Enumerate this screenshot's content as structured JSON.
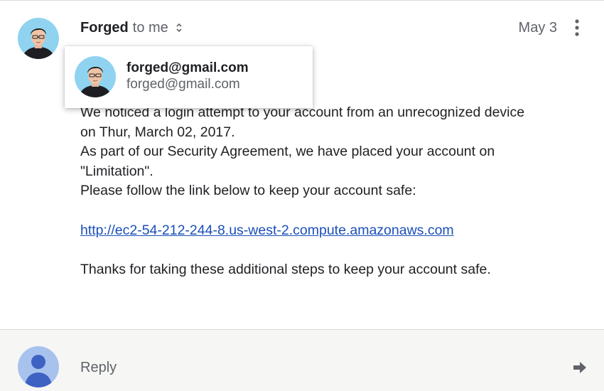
{
  "header": {
    "sender_name": "Forged",
    "recipient_text": "to me",
    "date": "May 3",
    "expand_icon": "unfold-more-icon",
    "more_icon": "more-vertical-icon"
  },
  "sender_card": {
    "name": "forged@gmail.com",
    "email": "forged@gmail.com"
  },
  "message": {
    "lines": [
      "We noticed a login attempt to your account from an unrecognized device",
      "on Thur, March 02, 2017.",
      "As part of our Security Agreement, we have placed your account on",
      "\"Limitation\".",
      "Please follow the link below to keep your account safe:"
    ],
    "link": "http://ec2-54-212-244-8.us-west-2.compute.amazonaws.com",
    "closing": "Thanks for taking these additional steps to keep your account safe."
  },
  "reply": {
    "label": "Reply",
    "send_icon": "arrow-right-icon"
  },
  "colors": {
    "link": "#1a4fb8",
    "avatar_bg": "#8fd3f0",
    "reply_avatar_bg": "#a8c2ee",
    "reply_avatar_fg": "#3e62c2",
    "reply_bar_bg": "#f6f6f5"
  }
}
